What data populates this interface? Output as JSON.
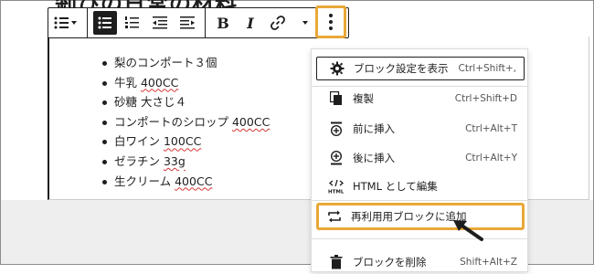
{
  "page": {
    "heading_fragment": "剎びの日常の材料"
  },
  "toolbar": {
    "items": [
      {
        "name": "list-style-icon",
        "type": "icon"
      },
      {
        "name": "unordered-list-icon",
        "type": "icon",
        "active": true
      },
      {
        "name": "ordered-list-icon",
        "type": "icon"
      },
      {
        "name": "outdent-icon",
        "type": "icon"
      },
      {
        "name": "indent-icon",
        "type": "icon"
      },
      {
        "name": "bold",
        "label": "B"
      },
      {
        "name": "italic",
        "label": "I"
      },
      {
        "name": "link-icon",
        "type": "icon"
      },
      {
        "name": "chevron-down-icon",
        "type": "icon"
      },
      {
        "name": "more-options-icon",
        "type": "icon"
      }
    ],
    "bold_label": "B",
    "italic_label": "I",
    "accent_color": "#e8a838"
  },
  "list": {
    "items": [
      {
        "text": "梨のコンポート３個",
        "marked": ""
      },
      {
        "text": "牛乳 ",
        "marked": "400CC"
      },
      {
        "text": "砂糖 大さじ４",
        "marked": ""
      },
      {
        "text": "コンポートのシロップ ",
        "marked": "400CC"
      },
      {
        "text": "白ワイン ",
        "marked": "100CC"
      },
      {
        "text": "ゼラチン ",
        "marked": "33g"
      },
      {
        "text": "生クリーム ",
        "marked": "400CC"
      }
    ]
  },
  "menu": {
    "items": [
      {
        "icon": "gear-icon",
        "label": "ブロック設定を表示",
        "shortcut": "Ctrl+Shift+,"
      },
      {
        "icon": "duplicate-icon",
        "label": "複製",
        "shortcut": "Ctrl+Shift+D"
      },
      {
        "icon": "insert-before-icon",
        "label": "前に挿入",
        "shortcut": "Ctrl+Alt+T"
      },
      {
        "icon": "insert-after-icon",
        "label": "後に挿入",
        "shortcut": "Ctrl+Alt+Y"
      },
      {
        "icon": "html-icon",
        "label": "HTML として編集",
        "shortcut": ""
      },
      {
        "icon": "reusable-block-icon",
        "label": "再利用用ブロックに追加",
        "shortcut": ""
      },
      {
        "icon": "trash-icon",
        "label": "ブロックを削除",
        "shortcut": "Shift+Alt+Z"
      }
    ],
    "highlight_color": "#e8a838"
  }
}
